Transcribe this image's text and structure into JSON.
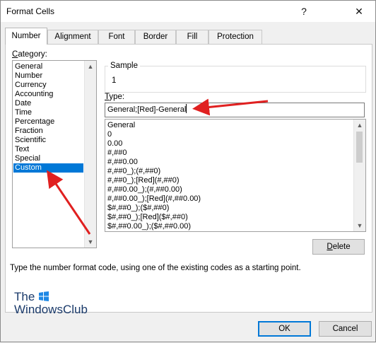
{
  "window": {
    "title": "Format Cells",
    "help_glyph": "?",
    "close_glyph": "✕"
  },
  "tabs": [
    {
      "label": "Number",
      "active": true
    },
    {
      "label": "Alignment",
      "active": false
    },
    {
      "label": "Font",
      "active": false
    },
    {
      "label": "Border",
      "active": false
    },
    {
      "label": "Fill",
      "active": false
    },
    {
      "label": "Protection",
      "active": false
    }
  ],
  "category": {
    "label": "Category:",
    "items": [
      "General",
      "Number",
      "Currency",
      "Accounting",
      "Date",
      "Time",
      "Percentage",
      "Fraction",
      "Scientific",
      "Text",
      "Special",
      "Custom"
    ],
    "selected": "Custom"
  },
  "sample": {
    "label": "Sample",
    "value": "1"
  },
  "type": {
    "label": "Type:",
    "value": "General;[Red]-General",
    "formats": [
      "General",
      "0",
      "0.00",
      "#,##0",
      "#,##0.00",
      "#,##0_);(#,##0)",
      "#,##0_);[Red](#,##0)",
      "#,##0.00_);(#,##0.00)",
      "#,##0.00_);[Red](#,##0.00)",
      "$#,##0_);($#,##0)",
      "$#,##0_);[Red]($#,##0)",
      "$#,##0.00_);($#,##0.00)"
    ]
  },
  "buttons": {
    "delete": "Delete",
    "ok": "OK",
    "cancel": "Cancel"
  },
  "hint": "Type the number format code, using one of the existing codes as a starting point.",
  "watermark": {
    "line1": "The",
    "line2": "WindowsClub"
  },
  "colors": {
    "accent": "#0078d7",
    "annotation_arrow": "#e02020"
  }
}
